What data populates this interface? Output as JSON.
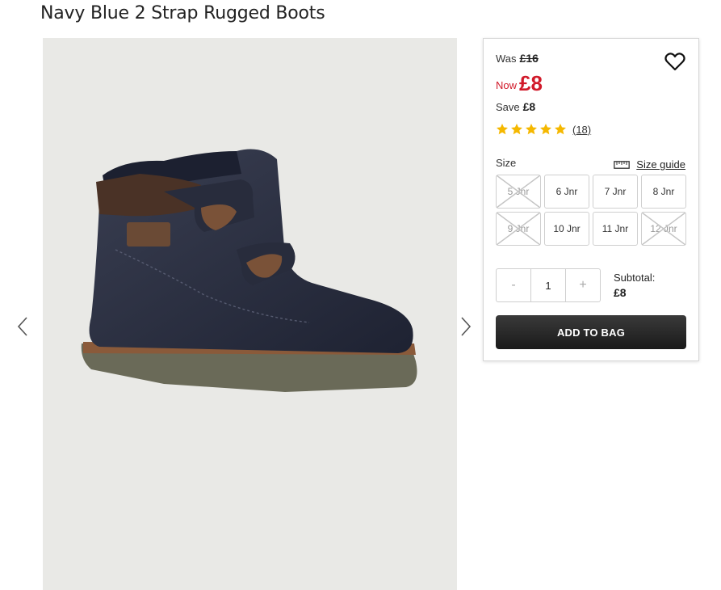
{
  "product": {
    "title": "Navy Blue 2 Strap Rugged Boots"
  },
  "pricing": {
    "was_label": "Was",
    "was_price": "£16",
    "now_label": "Now",
    "now_price": "£8",
    "save_label": "Save",
    "save_amount": "£8",
    "sale_color": "#d11a2a"
  },
  "rating": {
    "stars": 5,
    "max_stars": 5,
    "review_count": "(18)",
    "star_color": "#f5b800"
  },
  "size": {
    "label": "Size",
    "guide_label": "Size guide",
    "options": [
      {
        "label": "5 Jnr",
        "available": false
      },
      {
        "label": "6 Jnr",
        "available": true
      },
      {
        "label": "7 Jnr",
        "available": true
      },
      {
        "label": "8 Jnr",
        "available": true
      },
      {
        "label": "9 Jnr",
        "available": false
      },
      {
        "label": "10 Jnr",
        "available": true
      },
      {
        "label": "11 Jnr",
        "available": true
      },
      {
        "label": "12 Jnr",
        "available": false
      }
    ]
  },
  "quantity": {
    "minus": "-",
    "value": "1",
    "plus": "+"
  },
  "subtotal": {
    "label": "Subtotal:",
    "amount": "£8"
  },
  "cart": {
    "add_label": "ADD TO BAG"
  },
  "icons": {
    "wishlist": "heart-icon",
    "prev": "chevron-left-icon",
    "next": "chevron-right-icon",
    "size_guide": "ruler-icon"
  }
}
